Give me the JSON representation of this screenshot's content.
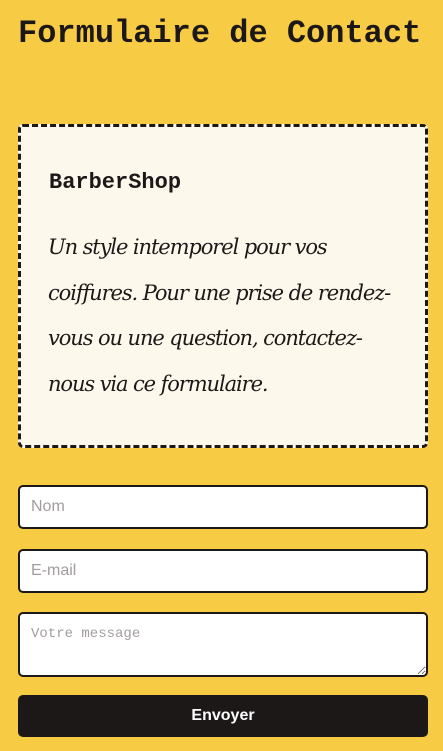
{
  "page": {
    "title": "Formulaire de Contact"
  },
  "card": {
    "brand": "BarberShop",
    "description": "Un style intemporel pour vos coiffures. Pour une prise de rendez-vous ou une question, contactez-nous via ce formulaire."
  },
  "form": {
    "name_placeholder": "Nom",
    "email_placeholder": "E-mail",
    "message_placeholder": "Votre message",
    "submit_label": "Envoyer"
  },
  "colors": {
    "background": "#f8cb45",
    "card_background": "#fdf8ec",
    "ink": "#1c1818",
    "placeholder": "#a39d9d"
  }
}
